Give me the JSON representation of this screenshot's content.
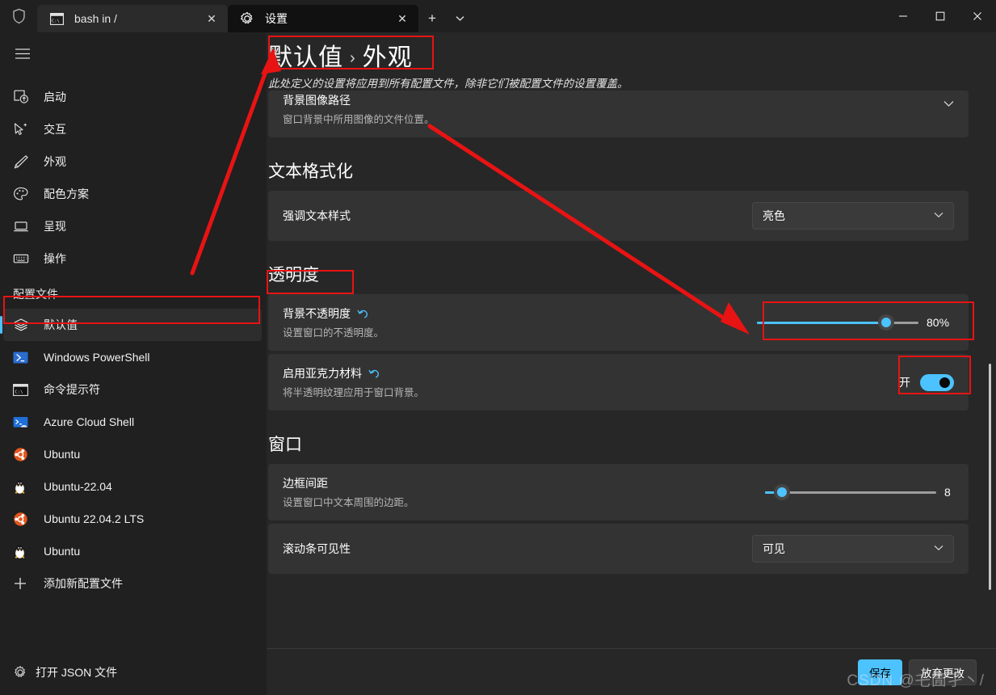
{
  "window": {
    "controls": {
      "minimize": "—",
      "maximize": "▢",
      "close": "✕"
    }
  },
  "tabs": [
    {
      "title": "bash in /",
      "icon": "console-icon",
      "active": false,
      "close": "✕"
    },
    {
      "title": "设置",
      "icon": "gear-icon",
      "active": true,
      "close": "✕"
    }
  ],
  "tabbar": {
    "new_tab": "+",
    "dropdown": "⌄"
  },
  "sidebar": {
    "menu_icon": "hamburger-icon",
    "items": [
      {
        "label": "启动",
        "icon": "startup-icon"
      },
      {
        "label": "交互",
        "icon": "interaction-icon"
      },
      {
        "label": "外观",
        "icon": "appearance-brush-icon"
      },
      {
        "label": "配色方案",
        "icon": "color-palette-icon"
      },
      {
        "label": "呈现",
        "icon": "rendering-icon"
      },
      {
        "label": "操作",
        "icon": "actions-keyboard-icon"
      }
    ],
    "profiles_header": "配置文件",
    "profiles": [
      {
        "label": "默认值",
        "icon": "defaults-layers-icon",
        "selected": true
      },
      {
        "label": "Windows PowerShell",
        "icon": "powershell-icon",
        "selected": false
      },
      {
        "label": "命令提示符",
        "icon": "cmd-icon",
        "selected": false
      },
      {
        "label": "Azure Cloud Shell",
        "icon": "azure-icon",
        "selected": false
      },
      {
        "label": "Ubuntu",
        "icon": "ubuntu-icon",
        "selected": false
      },
      {
        "label": "Ubuntu-22.04",
        "icon": "tux-icon",
        "selected": false
      },
      {
        "label": "Ubuntu 22.04.2 LTS",
        "icon": "ubuntu-icon",
        "selected": false
      },
      {
        "label": "Ubuntu",
        "icon": "tux-icon",
        "selected": false
      },
      {
        "label": "添加新配置文件",
        "icon": "plus-icon",
        "selected": false
      }
    ],
    "footer": {
      "label": "打开 JSON 文件",
      "icon": "gear-icon"
    }
  },
  "page": {
    "breadcrumb_parent": "默认值",
    "breadcrumb_sep": "›",
    "breadcrumb_current": "外观",
    "subtitle": "此处定义的设置将应用到所有配置文件，除非它们被配置文件的设置覆盖。"
  },
  "settings": {
    "background_image": {
      "title": "背景图像路径",
      "desc": "窗口背景中所用图像的文件位置。",
      "expand_icon": "chevron-down-icon"
    },
    "text_formatting": {
      "section": "文本格式化",
      "accent_text_style": {
        "title": "强调文本样式",
        "value": "亮色",
        "chevron": "⌄"
      }
    },
    "transparency": {
      "section": "透明度",
      "background_opacity": {
        "title": "背景不透明度",
        "desc": "设置窗口的不透明度。",
        "reset_icon": "↺",
        "value_label": "80%",
        "value_percent": 80
      },
      "acrylic": {
        "title": "启用亚克力材料",
        "desc": "将半透明纹理应用于窗口背景。",
        "reset_icon": "↺",
        "toggle_label": "开",
        "toggle_on": true
      }
    },
    "window": {
      "section": "窗口",
      "padding": {
        "title": "边框间距",
        "desc": "设置窗口中文本周围的边距。",
        "value_label": "8",
        "value_percent": 10
      },
      "scrollbar_visibility": {
        "title": "滚动条可见性",
        "value": "可见",
        "chevron": "⌄"
      }
    }
  },
  "actions": {
    "save": "保存",
    "discard": "放弃更改"
  },
  "watermark": "CSDN @乇圊孑丶/",
  "colors": {
    "accent": "#4cc2ff",
    "annotation": "#e81313",
    "card": "#333333",
    "page_bg": "#272727",
    "chrome_bg": "#202020"
  }
}
